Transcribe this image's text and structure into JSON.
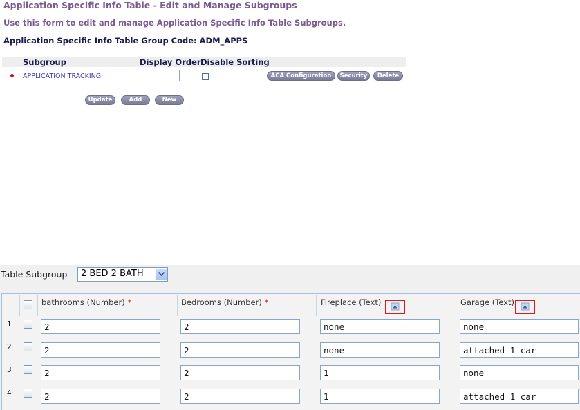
{
  "form": {
    "title": "Application Specific Info Table - Edit and Manage Subgroups",
    "instructions": "Use this form to edit and manage Application Specific Info Table Subgroups.",
    "group_code": "Application Specific Info Table Group Code: ADM_APPS",
    "headers": {
      "subgroup": "Subgroup",
      "display_order": "Display Order",
      "disable_sorting": "Disable Sorting"
    },
    "row": {
      "subgroup_name": "APPLICATION TRACKING",
      "display_order": "",
      "disable_sorting": false,
      "aca_label": "ACA Configuration",
      "security_label": "Security",
      "delete_label": "Delete"
    },
    "update_label": "Update",
    "add_label": "Add",
    "new_label": "New"
  },
  "table_subgroup": {
    "label": "Table Subgroup",
    "selected": "2 BED 2 BATH",
    "columns": [
      {
        "label": "bathrooms (Number)",
        "required": "*"
      },
      {
        "label": "Bedrooms (Number)",
        "required": "*"
      },
      {
        "label": "Fireplace (Text)",
        "required": ""
      },
      {
        "label": "Garage (Text)",
        "required": ""
      }
    ],
    "rows": [
      {
        "num": "1",
        "bathrooms": "2",
        "bedrooms": "2",
        "fireplace": "none",
        "garage": "none"
      },
      {
        "num": "2",
        "bathrooms": "2",
        "bedrooms": "2",
        "fireplace": "none",
        "garage": "attached 1 car"
      },
      {
        "num": "3",
        "bathrooms": "2",
        "bedrooms": "2",
        "fireplace": "1",
        "garage": "none"
      },
      {
        "num": "4",
        "bathrooms": "2",
        "bedrooms": "2",
        "fireplace": "1",
        "garage": "attached 1 car"
      }
    ]
  },
  "colors": {
    "title": "#7b5b91",
    "code": "#1b1b50",
    "link": "#3b3bbb",
    "bullet": "#c0142c",
    "button": "#8a8aa8",
    "highlight": "#e01818"
  },
  "icons": {
    "sort": "sort-icon",
    "dropdown": "chevron-down-icon"
  }
}
